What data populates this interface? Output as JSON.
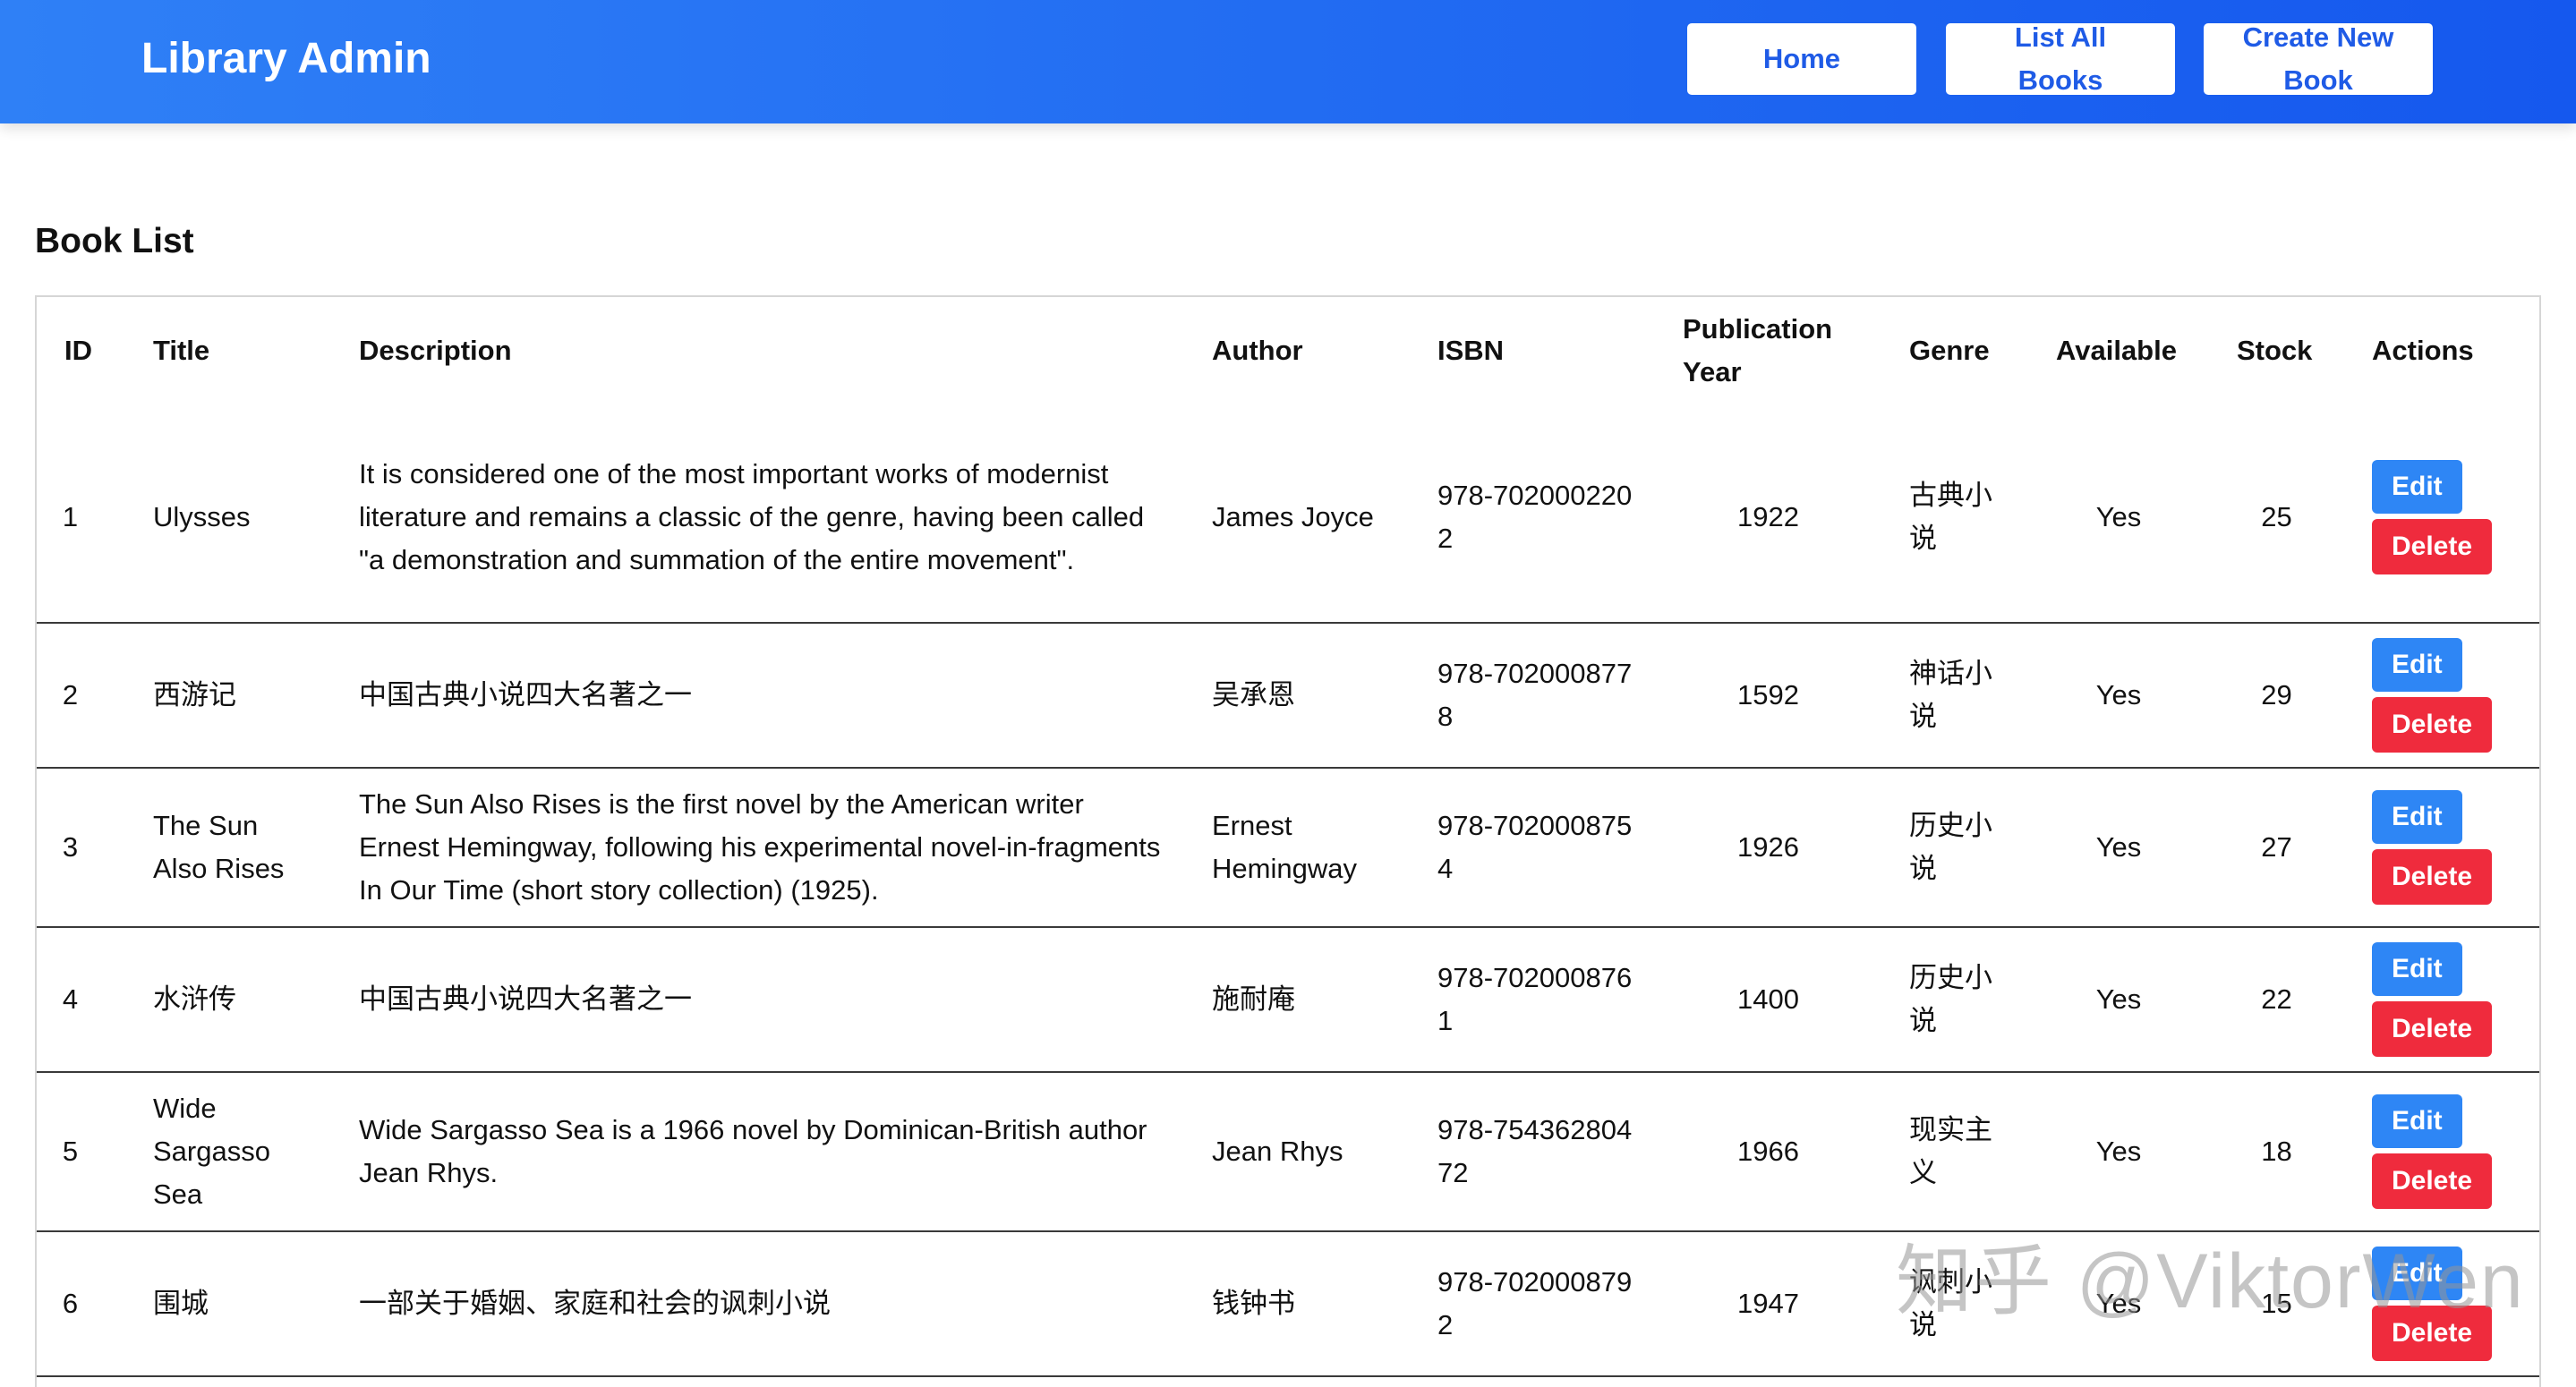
{
  "navbar": {
    "brand": "Library Admin",
    "home_label": "Home",
    "list_label": "List All Books",
    "create_label": "Create New Book"
  },
  "page": {
    "title": "Book List"
  },
  "table": {
    "headers": {
      "id": "ID",
      "title": "Title",
      "description": "Description",
      "author": "Author",
      "isbn": "ISBN",
      "year": "Publication Year",
      "genre": "Genre",
      "available": "Available",
      "stock": "Stock",
      "actions": "Actions"
    },
    "edit_label": "Edit",
    "delete_label": "Delete",
    "rows": [
      {
        "id": "1",
        "title": "Ulysses",
        "description": "It is considered one of the most important works of modernist literature and remains a classic of the genre, having been called \"a demonstration and summation of the entire movement\".",
        "author": "James Joyce",
        "isbn": "978-7020002202",
        "year": "1922",
        "genre": "古典小说",
        "available": "Yes",
        "stock": "25"
      },
      {
        "id": "2",
        "title": "西游记",
        "description": "中国古典小说四大名著之一",
        "author": "吴承恩",
        "isbn": "978-7020008778",
        "year": "1592",
        "genre": "神话小说",
        "available": "Yes",
        "stock": "29"
      },
      {
        "id": "3",
        "title": "The Sun Also Rises",
        "description": "The Sun Also Rises is the first novel by the American writer Ernest Hemingway, following his experimental novel-in-fragments In Our Time (short story collection) (1925).",
        "author": "Ernest Hemingway",
        "isbn": "978-7020008754",
        "year": "1926",
        "genre": "历史小说",
        "available": "Yes",
        "stock": "27"
      },
      {
        "id": "4",
        "title": "水浒传",
        "description": "中国古典小说四大名著之一",
        "author": "施耐庵",
        "isbn": "978-7020008761",
        "year": "1400",
        "genre": "历史小说",
        "available": "Yes",
        "stock": "22"
      },
      {
        "id": "5",
        "title": "Wide Sargasso Sea",
        "description": "Wide Sargasso Sea is a 1966 novel by Dominican-British author Jean Rhys.",
        "author": "Jean Rhys",
        "isbn": "978-75436280472",
        "year": "1966",
        "genre": "现实主义",
        "available": "Yes",
        "stock": "18"
      },
      {
        "id": "6",
        "title": "围城",
        "description": "一部关于婚姻、家庭和社会的讽刺小说",
        "author": "钱钟书",
        "isbn": "978-7020008792",
        "year": "1947",
        "genre": "讽刺小说",
        "available": "Yes",
        "stock": "15"
      }
    ]
  },
  "watermark": "知乎 @ViktorWen"
}
